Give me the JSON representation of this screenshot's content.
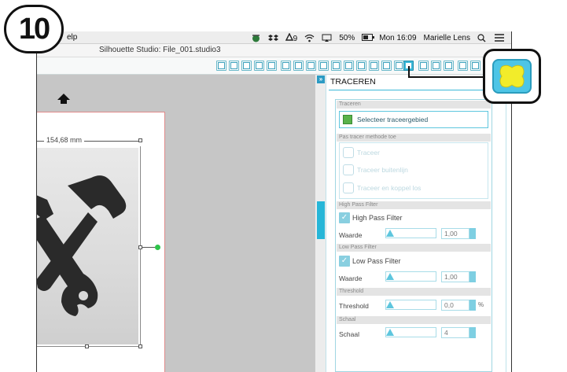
{
  "step_number": "10",
  "menubar": {
    "menu_fragment": "elp",
    "wifi_label": "9",
    "battery": "50%",
    "clock": "Mon 16:09",
    "user": "Marielle Lens"
  },
  "window": {
    "title": "Silhouette Studio: File_001.studio3"
  },
  "canvas": {
    "dimension_label": "154,68 mm"
  },
  "panel": {
    "tab_title": "TRACEREN",
    "section_trace": "Traceren",
    "select_area_button": "Selecteer traceergebied",
    "section_method": "Pas tracer methode toe",
    "methods": [
      "Traceer",
      "Traceer buitenlijn",
      "Traceer en koppel los"
    ],
    "section_high_pass": "High Pass Filter",
    "high_pass_label": "High Pass Filter",
    "high_pass_checked": true,
    "value_label": "Waarde",
    "high_pass_value": "1,00",
    "section_low_pass": "Low Pass Filter",
    "low_pass_label": "Low Pass Filter",
    "low_pass_checked": true,
    "low_pass_value": "1,00",
    "section_threshold": "Threshold",
    "threshold_label": "Threshold",
    "threshold_value": "0,0",
    "threshold_unit": "%",
    "section_scale": "Schaal",
    "scale_label": "Schaal",
    "scale_value": "4"
  },
  "colors": {
    "accent": "#3cb8d8",
    "highlight_yellow": "#f2ec2a",
    "handle_dot": "#2ec44a",
    "page_border": "#e08a8a"
  }
}
